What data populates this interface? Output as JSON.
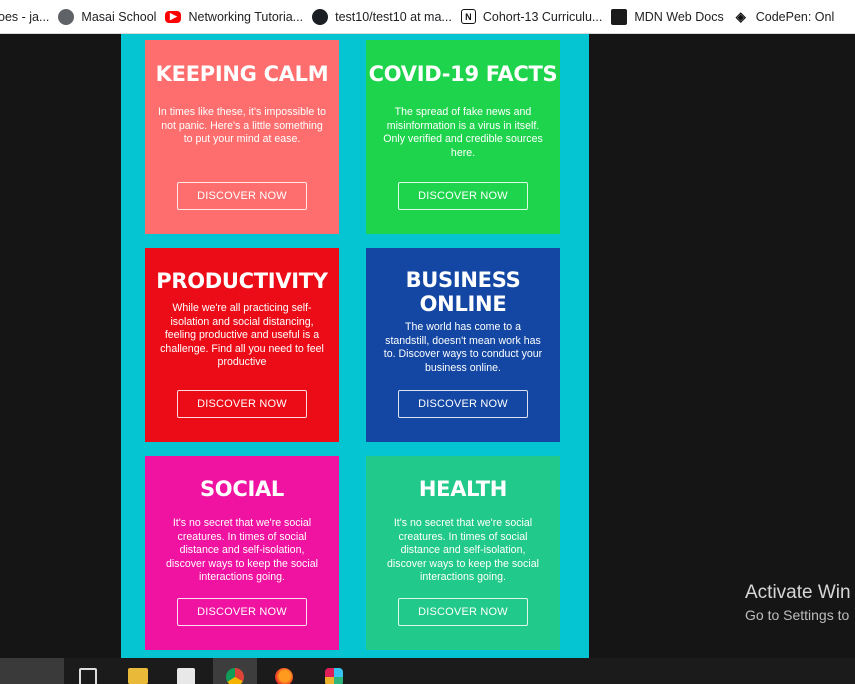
{
  "bookmarks": [
    {
      "label": "oes - ja...",
      "icon": "bookmark-icon"
    },
    {
      "label": "Masai School",
      "icon": "globe-icon"
    },
    {
      "label": "Networking Tutoria...",
      "icon": "youtube-icon"
    },
    {
      "label": "test10/test10 at ma...",
      "icon": "github-icon"
    },
    {
      "label": "Cohort-13 Curriculu...",
      "icon": "notion-icon"
    },
    {
      "label": "MDN Web Docs",
      "icon": "mdn-icon"
    },
    {
      "label": "CodePen: Onl",
      "icon": "codepen-icon"
    }
  ],
  "cards": [
    {
      "title": "KEEPING CALM",
      "text": "In times like these, it's impossible to not panic. Here's a little something to put your mind at ease.",
      "button": "DISCOVER NOW",
      "color": "#ff6e6e"
    },
    {
      "title": "COVID-19 FACTS",
      "text": "The spread of fake news and misinformation is a virus in itself. Only verified and credible sources here.",
      "button": "DISCOVER NOW",
      "color": "#1ed44c"
    },
    {
      "title": "PRODUCTIVITY",
      "text": "While we're all practicing self-isolation and social distancing, feeling productive and useful is a challenge. Find all you need to feel productive",
      "button": "DISCOVER NOW",
      "color": "#ec0c17"
    },
    {
      "title": "BUSINESS ONLINE",
      "text": "The world has come to a standstill, doesn't mean work has to. Discover ways to conduct your business online.",
      "button": "DISCOVER NOW",
      "color": "#1347a3"
    },
    {
      "title": "SOCIAL",
      "text": "It's no secret that we're social creatures. In times of social distance and self-isolation, discover ways to keep the social interactions going.",
      "button": "DISCOVER NOW",
      "color": "#f012a0"
    },
    {
      "title": "HEALTH",
      "text": "It's no secret that we're social creatures. In times of social distance and self-isolation, discover ways to keep the social interactions going.",
      "button": "DISCOVER NOW",
      "color": "#21c98a"
    }
  ],
  "panel_color": "#05c5d2",
  "watermark": {
    "line1": "Activate Win",
    "line2": "Go to Settings to"
  },
  "taskbar": [
    {
      "name": "task-view",
      "icon": "task-view-icon"
    },
    {
      "name": "file-explorer",
      "icon": "folder-icon"
    },
    {
      "name": "store",
      "icon": "store-icon"
    },
    {
      "name": "chrome",
      "icon": "chrome-icon"
    },
    {
      "name": "firefox",
      "icon": "firefox-icon"
    },
    {
      "name": "slack",
      "icon": "slack-icon"
    }
  ]
}
